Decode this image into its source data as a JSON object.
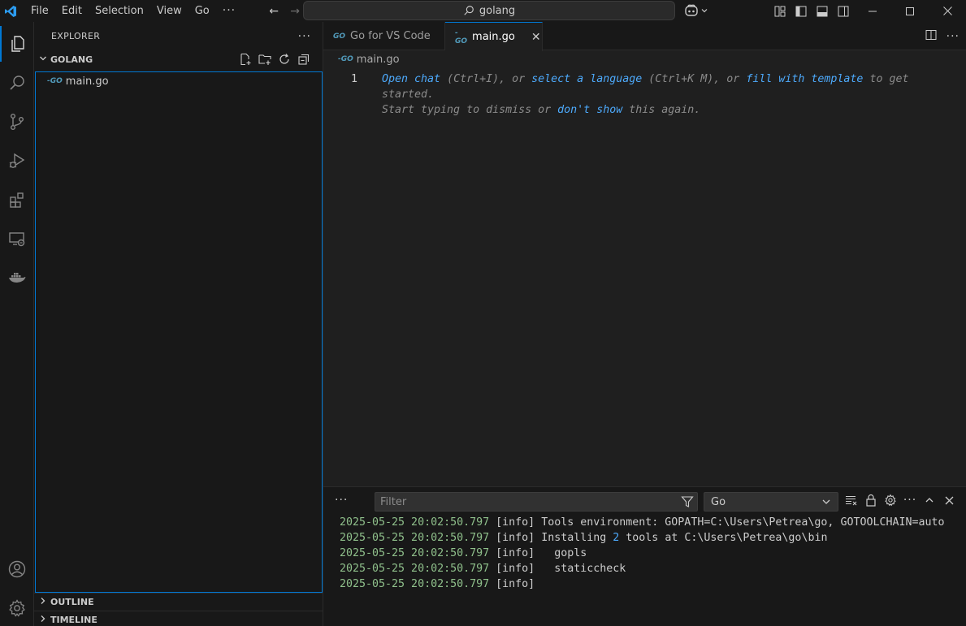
{
  "titlebar": {
    "menu": [
      "File",
      "Edit",
      "Selection",
      "View",
      "Go"
    ],
    "more": "···",
    "search_text": "golang"
  },
  "explorer": {
    "header": "EXPLORER",
    "more": "···",
    "folder": "GOLANG",
    "files": [
      {
        "name": "main.go",
        "icon_text": "-GO"
      }
    ],
    "outline": "OUTLINE",
    "timeline": "TIMELINE"
  },
  "editor": {
    "tabs": [
      {
        "label": "Go for VS Code",
        "icon_text": "GO",
        "active": false
      },
      {
        "label": "main.go",
        "icon_text": "-GO",
        "active": true,
        "close": "✕"
      }
    ],
    "breadcrumb": {
      "icon_text": "-GO",
      "file": "main.go"
    },
    "line_number": "1",
    "hint": {
      "open_chat": "Open chat",
      "t1": " (Ctrl+I), or ",
      "select_language": "select a language",
      "t2": " (Ctrl+K M), or ",
      "fill_template": "fill with template",
      "t3": " to get",
      "t4": "started.",
      "t5": "Start typing to dismiss or ",
      "dont_show": "don't show",
      "t6": " this again."
    }
  },
  "panel": {
    "more": "···",
    "filter_placeholder": "Filter",
    "channel": "Go",
    "log": [
      {
        "ts": "2025-05-25 20:02:50.797",
        "level": "[info]",
        "msg": " Tools environment: GOPATH=C:\\Users\\Petrea\\go, GOTOOLCHAIN=auto"
      },
      {
        "ts": "2025-05-25 20:02:50.797",
        "level": "[info]",
        "msg_a": " Installing ",
        "msg_num": "2",
        "msg_b": " tools at C:\\Users\\Petrea\\go\\bin"
      },
      {
        "ts": "2025-05-25 20:02:50.797",
        "level": "[info]",
        "msg": "   gopls"
      },
      {
        "ts": "2025-05-25 20:02:50.797",
        "level": "[info]",
        "msg": "   staticcheck"
      },
      {
        "ts": "2025-05-25 20:02:50.797",
        "level": "[info]",
        "msg": ""
      }
    ]
  },
  "colors": {
    "accent": "#0078d4",
    "link": "#4daafc",
    "timestamp": "#8fc08b",
    "go_icon": "#519aba"
  }
}
